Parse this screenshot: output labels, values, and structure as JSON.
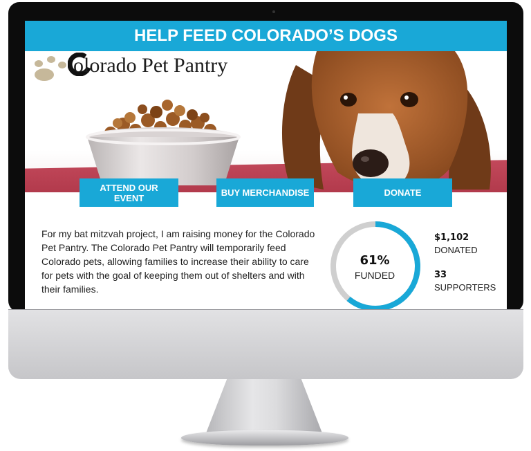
{
  "header": {
    "title": "HELP FEED COLORADO’S DOGS"
  },
  "logo": {
    "text": "olorado Pet Pantry"
  },
  "buttons": {
    "event": "ATTEND OUR EVENT",
    "merch": "BUY MERCHANDISE",
    "donate": "DONATE"
  },
  "description": "For my bat mitzvah project, I am raising money for the Colorado Pet Pantry. The Colorado Pet Pantry will temporarily feed Colorado pets, allowing families to increase their ability to care for pets with the goal of keeping them out of shelters and with their families.",
  "progress": {
    "percent_label": "61%",
    "funded_label": "FUNDED",
    "fraction": 0.61
  },
  "stats": {
    "donated_value": "$1,102",
    "donated_label": "DONATED",
    "supporters_value": "33",
    "supporters_label": "SUPPORTERS"
  },
  "colors": {
    "accent": "#19a8d7",
    "ring_track": "#cfcfcf"
  }
}
